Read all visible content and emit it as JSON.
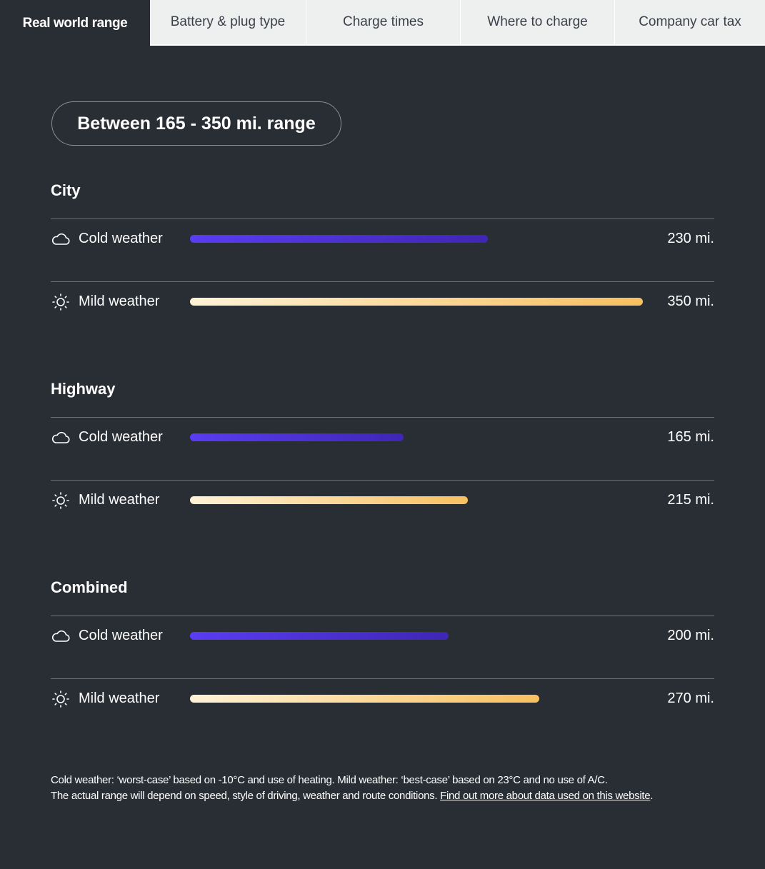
{
  "tabs": [
    {
      "label": "Real world range",
      "active": true
    },
    {
      "label": "Battery & plug type",
      "active": false
    },
    {
      "label": "Charge times",
      "active": false
    },
    {
      "label": "Where to charge",
      "active": false
    },
    {
      "label": "Company car tax",
      "active": false
    }
  ],
  "range_summary": "Between 165 - 350 mi. range",
  "scale_max_mi": 350,
  "colors": {
    "background": "#292e35",
    "cold_bar": "#5a3cf2",
    "mild_bar": "#f7c060"
  },
  "sections": [
    {
      "title": "City",
      "rows": [
        {
          "icon": "cloud-icon",
          "label": "Cold weather",
          "value_mi": 230,
          "value_text": "230 mi."
        },
        {
          "icon": "sun-icon",
          "label": "Mild weather",
          "value_mi": 350,
          "value_text": "350 mi."
        }
      ]
    },
    {
      "title": "Highway",
      "rows": [
        {
          "icon": "cloud-icon",
          "label": "Cold weather",
          "value_mi": 165,
          "value_text": "165 mi."
        },
        {
          "icon": "sun-icon",
          "label": "Mild weather",
          "value_mi": 215,
          "value_text": "215 mi."
        }
      ]
    },
    {
      "title": "Combined",
      "rows": [
        {
          "icon": "cloud-icon",
          "label": "Cold weather",
          "value_mi": 200,
          "value_text": "200 mi."
        },
        {
          "icon": "sun-icon",
          "label": "Mild weather",
          "value_mi": 270,
          "value_text": "270 mi."
        }
      ]
    }
  ],
  "footnote": {
    "line1": "Cold weather: ‘worst-case’ based on -10°C and use of heating. Mild weather: ‘best-case’ based on 23°C and no use of A/C.",
    "line2": "The actual range will depend on speed, style of driving, weather and route conditions. ",
    "link_text": "Find out more about data used on this website",
    "trailing": "."
  }
}
